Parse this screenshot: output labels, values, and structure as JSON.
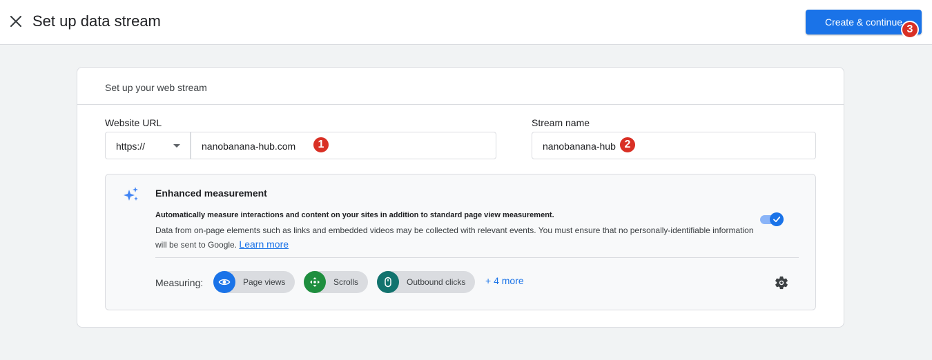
{
  "header": {
    "title": "Set up data stream",
    "primary_button": "Create & continue",
    "close_icon": "close-icon"
  },
  "badges": [
    "1",
    "2",
    "3"
  ],
  "card": {
    "title": "Set up your web stream",
    "website_url_label": "Website URL",
    "protocol": "https://",
    "website_url_value": "nanobanana-hub.com",
    "stream_name_label": "Stream name",
    "stream_name_value": "nanobanana-hub"
  },
  "enhanced_measurement": {
    "title": "Enhanced measurement",
    "description_bold": "Automatically measure interactions and content on your sites in addition to standard page view measurement.",
    "description": "Data from on-page elements such as links and embedded videos may be collected with relevant events. You must ensure that no personally-identifiable information will be sent to Google.",
    "learn_more": "Learn more",
    "toggle_on": true,
    "measuring_label": "Measuring:",
    "chips": [
      {
        "label": "Page views",
        "icon": "eye-icon",
        "color": "#1a73e8"
      },
      {
        "label": "Scrolls",
        "icon": "scroll-arrows-icon",
        "color": "#1e8e3e"
      },
      {
        "label": "Outbound clicks",
        "icon": "mouse-icon",
        "color": "#12736e"
      }
    ],
    "more": "+ 4 more"
  },
  "colors": {
    "accent": "#1a73e8",
    "badge": "#d93025"
  }
}
